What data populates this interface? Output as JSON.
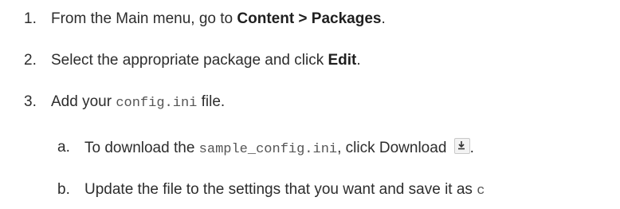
{
  "steps": [
    {
      "num": "1.",
      "before": "From the Main menu, go to ",
      "bold": "Content > Packages",
      "after": "."
    },
    {
      "num": "2.",
      "before": "Select the appropriate package and click ",
      "bold": "Edit",
      "after": "."
    },
    {
      "num": "3.",
      "before": "Add your ",
      "code": "config.ini",
      "after": " file."
    }
  ],
  "substeps": [
    {
      "num": "a.",
      "before": "To download the ",
      "code": "sample_config.ini",
      "after": ", click Download ",
      "icon": "download-icon",
      "trail": "."
    },
    {
      "num": "b.",
      "text": "Update the file to the settings that you want and save it as ",
      "trail": "c"
    }
  ]
}
